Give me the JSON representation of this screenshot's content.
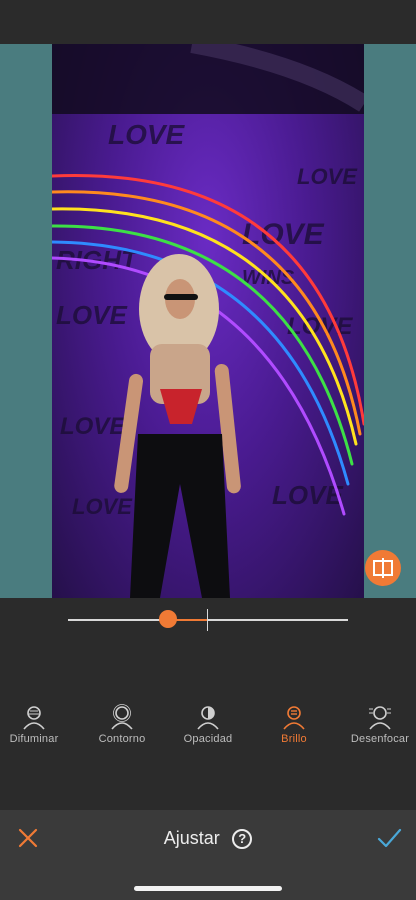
{
  "accent_color": "#f07a35",
  "canvas_bg_color": "#4a7c7f",
  "photo": {
    "description_icon": "photo-editing-canvas",
    "wall_words": [
      "LOVE",
      "LOVE",
      "RIGHT",
      "LOVE",
      "LOVE",
      "WINS",
      "LOVE",
      "LOVE",
      "LOVE",
      "LOVE"
    ]
  },
  "slider": {
    "value": 0.36
  },
  "tools": [
    {
      "label": "Difuminar",
      "icon": "blur-person-icon",
      "active": false
    },
    {
      "label": "Contorno",
      "icon": "outline-person-icon",
      "active": false
    },
    {
      "label": "Opacidad",
      "icon": "opacity-person-icon",
      "active": false
    },
    {
      "label": "Brillo",
      "icon": "brightness-person-icon",
      "active": true
    },
    {
      "label": "Desenfocar",
      "icon": "defocus-person-icon",
      "active": false
    }
  ],
  "bottom": {
    "title": "Ajustar",
    "help_label": "?",
    "close_icon": "close-icon",
    "confirm_icon": "check-icon"
  }
}
